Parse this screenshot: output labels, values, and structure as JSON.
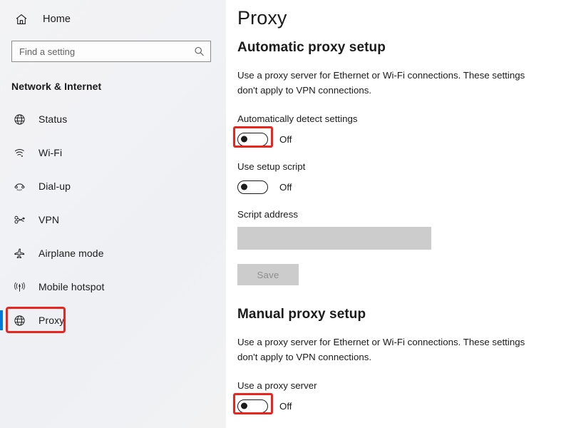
{
  "sidebar": {
    "home": {
      "label": "Home",
      "icon": "home-icon"
    },
    "search": {
      "value": "",
      "placeholder": "Find a setting",
      "icon": "search-icon"
    },
    "category_title": "Network & Internet",
    "items": [
      {
        "label": "Status",
        "icon": "globe-icon",
        "selected": false
      },
      {
        "label": "Wi-Fi",
        "icon": "wifi-icon",
        "selected": false
      },
      {
        "label": "Dial-up",
        "icon": "phone-handset-icon",
        "selected": false
      },
      {
        "label": "VPN",
        "icon": "vpn-key-icon",
        "selected": false
      },
      {
        "label": "Airplane mode",
        "icon": "airplane-icon",
        "selected": false
      },
      {
        "label": "Mobile hotspot",
        "icon": "hotspot-icon",
        "selected": false
      },
      {
        "label": "Proxy",
        "icon": "globe-icon",
        "selected": true
      }
    ]
  },
  "main": {
    "page_title": "Proxy",
    "automatic": {
      "heading": "Automatic proxy setup",
      "description": "Use a proxy server for Ethernet or Wi-Fi connections. These settings don't apply to VPN connections.",
      "auto_detect": {
        "label": "Automatically detect settings",
        "state": "Off"
      },
      "setup_script": {
        "label": "Use setup script",
        "state": "Off"
      },
      "script_address": {
        "label": "Script address",
        "value": "",
        "placeholder": ""
      },
      "save_label": "Save"
    },
    "manual": {
      "heading": "Manual proxy setup",
      "description": "Use a proxy server for Ethernet or Wi-Fi connections. These settings don't apply to VPN connections.",
      "use_proxy": {
        "label": "Use a proxy server",
        "state": "Off"
      }
    }
  },
  "colors": {
    "accent": "#0078d7",
    "annotation": "#e8251f",
    "text": "#1b1b1b",
    "disabled_fill": "#cccccc"
  }
}
